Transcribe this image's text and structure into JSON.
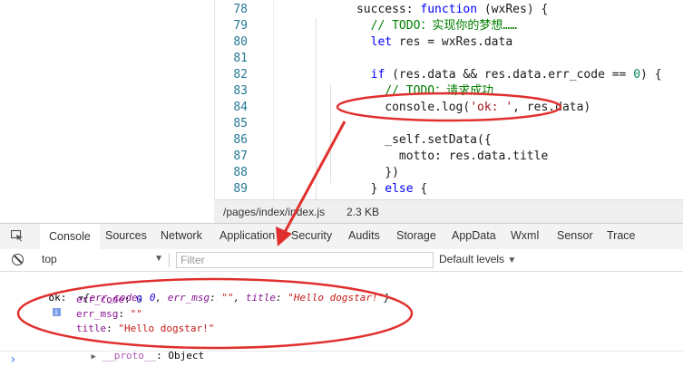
{
  "editor": {
    "lines": [
      {
        "num": "78",
        "segments": [
          {
            "t": "      success: ",
            "c": ""
          },
          {
            "t": "function",
            "c": "kw"
          },
          {
            "t": " (wxRes) {",
            "c": ""
          }
        ]
      },
      {
        "num": "79",
        "segments": [
          {
            "t": "        ",
            "c": ""
          },
          {
            "t": "// TODO：实现你的梦想……",
            "c": "cm"
          }
        ]
      },
      {
        "num": "80",
        "segments": [
          {
            "t": "        ",
            "c": ""
          },
          {
            "t": "let",
            "c": "kw"
          },
          {
            "t": " res = wxRes.data",
            "c": ""
          }
        ]
      },
      {
        "num": "81",
        "segments": [
          {
            "t": "",
            "c": ""
          }
        ]
      },
      {
        "num": "82",
        "segments": [
          {
            "t": "        ",
            "c": ""
          },
          {
            "t": "if",
            "c": "kw"
          },
          {
            "t": " (res.data && res.data.err_code == ",
            "c": ""
          },
          {
            "t": "0",
            "c": "num"
          },
          {
            "t": ") {",
            "c": ""
          }
        ]
      },
      {
        "num": "83",
        "segments": [
          {
            "t": "          ",
            "c": ""
          },
          {
            "t": "// TODO：请求成功",
            "c": "cm"
          }
        ]
      },
      {
        "num": "84",
        "segments": [
          {
            "t": "          console.log(",
            "c": ""
          },
          {
            "t": "'ok: '",
            "c": "str"
          },
          {
            "t": ", res.data)",
            "c": ""
          }
        ]
      },
      {
        "num": "85",
        "segments": [
          {
            "t": "",
            "c": ""
          }
        ]
      },
      {
        "num": "86",
        "segments": [
          {
            "t": "          _self.setData({",
            "c": ""
          }
        ]
      },
      {
        "num": "87",
        "segments": [
          {
            "t": "            motto: res.data.title",
            "c": ""
          }
        ]
      },
      {
        "num": "88",
        "segments": [
          {
            "t": "          })",
            "c": ""
          }
        ]
      },
      {
        "num": "89",
        "segments": [
          {
            "t": "        } ",
            "c": ""
          },
          {
            "t": "else",
            "c": "kw"
          },
          {
            "t": " {",
            "c": ""
          }
        ]
      }
    ]
  },
  "statusbar": {
    "path": "/pages/index/index.js",
    "size": "2.3 KB"
  },
  "tabs": [
    "Console",
    "Sources",
    "Network",
    "Application",
    "Security",
    "Audits",
    "Storage",
    "AppData",
    "Wxml",
    "Sensor",
    "Trace"
  ],
  "active_tab": "Console",
  "filterbar": {
    "context": "top",
    "filter_placeholder": "Filter",
    "levels": "Default levels"
  },
  "console": {
    "prefix": "ok:",
    "summary_open": "{",
    "summary_items": [
      {
        "k": "err_code",
        "v": "0",
        "type": "num"
      },
      {
        "k": "err_msg",
        "v": "\"\"",
        "type": "str"
      },
      {
        "k": "title",
        "v": "\"Hello dogstar!\"",
        "type": "str"
      }
    ],
    "summary_close": "}",
    "info_badge": "i",
    "props": [
      {
        "k": "err_code",
        "v": "0",
        "type": "num"
      },
      {
        "k": "err_msg",
        "v": "\"\"",
        "type": "str"
      },
      {
        "k": "title",
        "v": "\"Hello dogstar!\"",
        "type": "str"
      }
    ],
    "proto_key": "__proto__",
    "proto_val": "Object",
    "prompt": "›"
  },
  "colors": {
    "annotation": "#e0302e",
    "tab_active": "#1a73e8",
    "string": "#c41a16",
    "number": "#1c00cf",
    "key": "#881391"
  }
}
